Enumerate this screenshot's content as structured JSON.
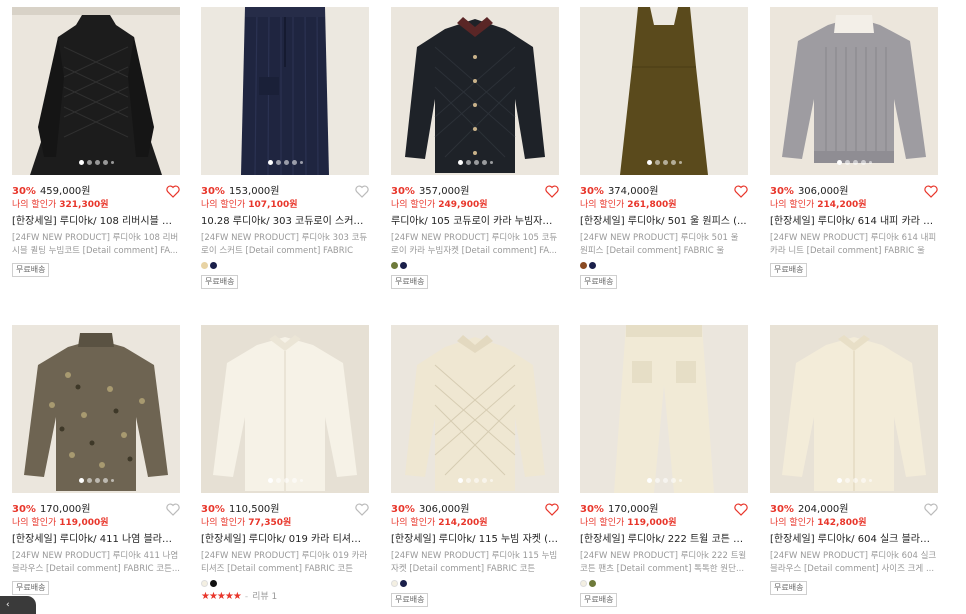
{
  "labels": {
    "my_price": "나의 할인가",
    "free_shipping": "무료배송",
    "review": "리뷰"
  },
  "products": [
    {
      "discount": "30%",
      "price": "459,000원",
      "my_price": "321,300원",
      "heart_filled": true,
      "title": "[한장세일] 루디아k/ 108 리버시블 퀼...",
      "desc": "[24FW NEW PRODUCT] 루디아k 108 리버시블 퀼팅 누빔코트 [Detail comment] FA...",
      "colors": [],
      "free_shipping": true
    },
    {
      "discount": "30%",
      "price": "153,000원",
      "my_price": "107,100원",
      "heart_filled": false,
      "title": "10.28 루디아k/ 303 코듀로이 스커트 (...",
      "desc": "[24FW NEW PRODUCT] 루디아k 303 코듀로이 스커트 [Detail comment] FABRIC 코...",
      "colors": [
        "#e8d3a4",
        "#1a1f4a"
      ],
      "free_shipping": true
    },
    {
      "discount": "30%",
      "price": "357,000원",
      "my_price": "249,900원",
      "heart_filled": true,
      "title": "루디아k/ 105 코듀로이 카라 누빔자켓...",
      "desc": "[24FW NEW PRODUCT] 루디아k 105 코듀로이 카라 누빔자켓 [Detail comment] FA...",
      "colors": [
        "#6e7a3a",
        "#1a1f4a"
      ],
      "free_shipping": true
    },
    {
      "discount": "30%",
      "price": "374,000원",
      "my_price": "261,800원",
      "heart_filled": true,
      "title": "[한장세일] 루디아k/ 501 울 원피스 (...",
      "desc": "[24FW NEW PRODUCT] 루디아k 501 울 원피스 [Detail comment] FABRIC 울100...",
      "colors": [
        "#8a4a22",
        "#1a1f4a"
      ],
      "free_shipping": true
    },
    {
      "discount": "30%",
      "price": "306,000원",
      "my_price": "214,200원",
      "heart_filled": true,
      "title": "[한장세일] 루디아k/ 614 내피 카라 니...",
      "desc": "[24FW NEW PRODUCT] 루디아k 614 내피 카라 니트 [Detail comment] FABRIC 울9...",
      "colors": [],
      "free_shipping": true
    },
    {
      "discount": "30%",
      "price": "170,000원",
      "my_price": "119,000원",
      "heart_filled": false,
      "title": "[한장세일] 루디아k/ 411 나염 블라우...",
      "desc": "[24FW NEW PRODUCT] 루디아k 411 나염 블라우스 [Detail comment] FABRIC 코튼...",
      "colors": [],
      "free_shipping": true
    },
    {
      "discount": "30%",
      "price": "110,500원",
      "my_price": "77,350원",
      "heart_filled": false,
      "title": "[한장세일] 루디아k/ 019 카라 티셔즈 ...",
      "desc": "[24FW NEW PRODUCT] 루디아k 019 카라 티셔즈 [Detail comment] FABRIC 코튼10...",
      "colors": [
        "#f3efe2",
        "#111111"
      ],
      "free_shipping": false,
      "stars": "★★★★★",
      "review_count": "1"
    },
    {
      "discount": "30%",
      "price": "306,000원",
      "my_price": "214,200원",
      "heart_filled": true,
      "title": "[한장세일] 루디아k/ 115 누빔 자켓 (크...",
      "desc": "[24FW NEW PRODUCT] 루디아k 115 누빔자켓 [Detail comment] FABRIC 코튼100...",
      "colors": [
        "#f3efe2",
        "#1a1f4a"
      ],
      "free_shipping": true
    },
    {
      "discount": "30%",
      "price": "170,000원",
      "my_price": "119,000원",
      "heart_filled": true,
      "title": "[한장세일] 루디아k/ 222 트윌 코튼 팬...",
      "desc": "[24FW NEW PRODUCT] 루디아k 222 트윌 코튼 팬츠 [Detail comment] 톡톡한 원단...",
      "colors": [
        "#f3efe2",
        "#6e7a3a"
      ],
      "free_shipping": true
    },
    {
      "discount": "30%",
      "price": "204,000원",
      "my_price": "142,800원",
      "heart_filled": false,
      "title": "[한장세일] 루디아k/ 604 실크 블라우...",
      "desc": "[24FW NEW PRODUCT] 루디아k 604 실크 블라우스 [Detail comment] 사이즈 크게 ...",
      "colors": [],
      "free_shipping": true
    }
  ]
}
